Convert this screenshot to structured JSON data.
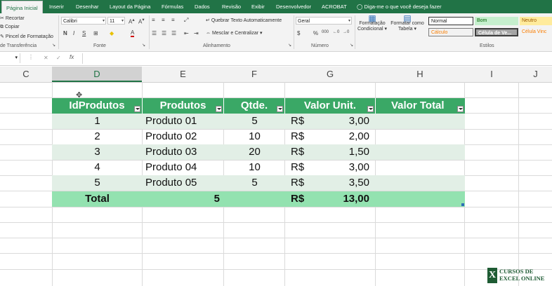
{
  "ribbon": {
    "tabs": [
      "Página Inicial",
      "Inserir",
      "Desenhar",
      "Layout da Página",
      "Fórmulas",
      "Dados",
      "Revisão",
      "Exibir",
      "Desenvolvedor",
      "ACROBAT"
    ],
    "tell_me": "Diga-me o que você deseja fazer",
    "clipboard": {
      "cut": "Recortar",
      "copy": "Copiar",
      "format_painter": "Pincel de Formatação",
      "label": "de Transferência"
    },
    "font": {
      "name": "Calibri",
      "size": "11",
      "bold": "N",
      "italic": "I",
      "underline": "S",
      "label": "Fonte"
    },
    "alignment": {
      "wrap": "Quebrar Texto Automaticamente",
      "merge": "Mesclar e Centralizar",
      "label": "Alinhamento"
    },
    "number": {
      "format": "Geral",
      "label": "Número",
      "currency": "$",
      "percent": "%",
      "thousands": "000"
    },
    "styles": {
      "cond_format": "Formatação Condicional",
      "format_table": "Formatar como Tabela",
      "normal": "Normal",
      "bom": "Bom",
      "neutro": "Neutro",
      "calculo": "Cálculo",
      "celula_verificacao": "Célula de Ve...",
      "celula_vinculada": "Célula Vinc",
      "label": "Estilos"
    }
  },
  "formula_bar": {
    "fx": "fx",
    "cancel": "✕",
    "enter": "✓",
    "value": ""
  },
  "columns": [
    "C",
    "D",
    "E",
    "F",
    "G",
    "H",
    "I",
    "J"
  ],
  "selected_column": "D",
  "table": {
    "headers": [
      "IdProdutos",
      "Produtos",
      "Qtde.",
      "Valor Unit.",
      "Valor Total"
    ],
    "rows": [
      {
        "id": "1",
        "produto": "Produto 01",
        "qtde": "5",
        "moeda": "R$",
        "valor": "3,00"
      },
      {
        "id": "2",
        "produto": "Produto 02",
        "qtde": "10",
        "moeda": "R$",
        "valor": "2,00"
      },
      {
        "id": "3",
        "produto": "Produto 03",
        "qtde": "20",
        "moeda": "R$",
        "valor": "1,50"
      },
      {
        "id": "4",
        "produto": "Produto 04",
        "qtde": "10",
        "moeda": "R$",
        "valor": "3,00"
      },
      {
        "id": "5",
        "produto": "Produto 05",
        "qtde": "5",
        "moeda": "R$",
        "valor": "3,50"
      }
    ],
    "total": {
      "label": "Total",
      "count": "5",
      "moeda": "R$",
      "valor": "13,00"
    }
  },
  "logo": {
    "line1": "CURSOS DE",
    "line2": "EXCEL ONLINE"
  },
  "colors": {
    "accent": "#217346",
    "header": "#3aa866",
    "band": "#e2efe6",
    "total": "#93e2b0"
  }
}
